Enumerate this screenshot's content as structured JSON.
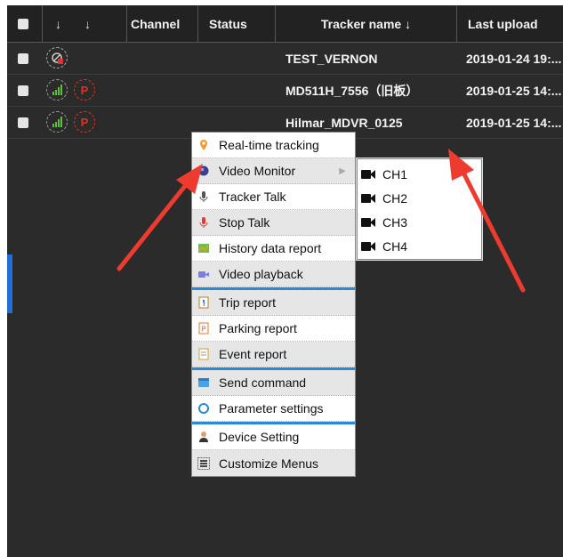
{
  "header": {
    "sort_icon_1": "↓",
    "sort_icon_2": "↓",
    "channel": "Channel",
    "status": "Status",
    "tracker_name": "Tracker name ↓",
    "last_upload": "Last upload"
  },
  "rows": [
    {
      "tracker_name": "TEST_VERNON",
      "last_upload": "2019-01-24 19:..."
    },
    {
      "tracker_name": "MD511H_7556（旧板）",
      "last_upload": "2019-01-25 14:..."
    },
    {
      "tracker_name": "Hilmar_MDVR_0125",
      "last_upload": "2019-01-25 14:..."
    }
  ],
  "context_menu": {
    "items": [
      {
        "label": "Real-time tracking",
        "icon": "location-pin-icon"
      },
      {
        "label": "Video Monitor",
        "icon": "camera-globe-icon",
        "has_submenu": true
      },
      {
        "label": "Tracker Talk",
        "icon": "microphone-icon"
      },
      {
        "label": "Stop Talk",
        "icon": "microphone-red-icon"
      },
      {
        "label": "History data report",
        "icon": "history-map-icon"
      },
      {
        "label": "Video playback",
        "icon": "video-playback-icon"
      },
      {
        "label": "Trip report",
        "icon": "trip-report-icon"
      },
      {
        "label": "Parking report",
        "icon": "parking-report-icon"
      },
      {
        "label": "Event report",
        "icon": "event-report-icon"
      },
      {
        "label": "Send command",
        "icon": "send-command-icon"
      },
      {
        "label": "Parameter settings",
        "icon": "parameter-settings-icon"
      },
      {
        "label": "Device Setting",
        "icon": "device-setting-icon"
      },
      {
        "label": "Customize Menus",
        "icon": "customize-menu-icon"
      }
    ]
  },
  "submenu": {
    "items": [
      {
        "label": "CH1",
        "icon": "video-camera-icon"
      },
      {
        "label": "CH2",
        "icon": "video-camera-icon"
      },
      {
        "label": "CH3",
        "icon": "video-camera-icon"
      },
      {
        "label": "CH4",
        "icon": "video-camera-icon"
      }
    ]
  },
  "colors": {
    "panel_bg": "#2b2b2b",
    "header_bg": "#222222",
    "menu_separator": "#2a8ad6",
    "annotation_arrow": "#ee3b2f",
    "signal_green": "#5fbf3a",
    "parking_red": "#d33322"
  },
  "row_icons": {
    "offline_icon": "offline-signal-icon",
    "signal_icon": "signal-bars-icon",
    "parking_icon": "parking-p-icon",
    "parking_letter": "P"
  }
}
